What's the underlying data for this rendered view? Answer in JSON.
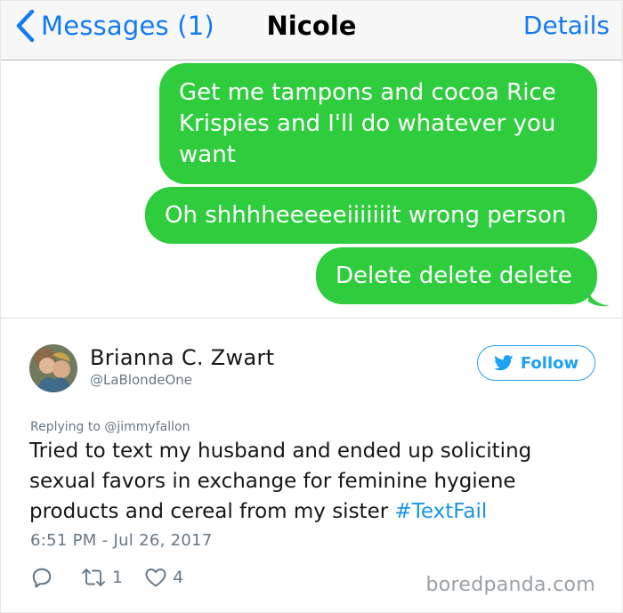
{
  "messages_screen": {
    "back_label": "Messages (1)",
    "contact_name": "Nicole",
    "details_label": "Details",
    "bubbles": [
      "Get me tampons and cocoa Rice Krispies and I'll do whatever you want",
      "Oh shhhheeeeeiiiiiiit wrong person",
      "Delete delete delete"
    ],
    "bubble_color": "#2fcd3e",
    "accent_color": "#127bf4"
  },
  "tweet": {
    "author_name": "Brianna C. Zwart",
    "author_handle": "@LaBlondeOne",
    "follow_label": "Follow",
    "replying_to": "Replying to @jimmyfallon",
    "text": "Tried to text my husband and ended up soliciting sexual favors in exchange for feminine hygiene products and cereal from my sister ",
    "hashtag": "#TextFail",
    "timestamp": "6:51 PM - Jul 26, 2017",
    "retweet_count": "1",
    "like_count": "4",
    "twitter_blue": "#1da1f2"
  },
  "watermark": "boredpanda.com"
}
